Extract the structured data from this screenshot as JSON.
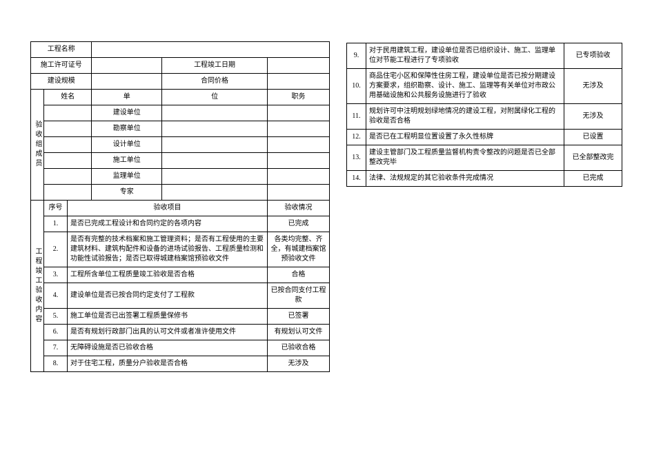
{
  "top": {
    "project_name_label": "工程名称",
    "permit_no_label": "施工许可证号",
    "completion_date_label": "工程竣工日期",
    "scale_label": "建设规模",
    "contract_price_label": "合同价格"
  },
  "group": {
    "side_label": "验收组成员",
    "name": "姓名",
    "unit": "单",
    "unit2": "位",
    "title": "职务",
    "rows": [
      "建设单位",
      "勘察单位",
      "设计单位",
      "施工单位",
      "监理单位"
    ],
    "expert": "专家"
  },
  "accept": {
    "side_label": "工程竣工验收内容",
    "seq": "序号",
    "item": "验收项目",
    "status": "验收情况",
    "rows": [
      {
        "n": "1.",
        "t": "是否已完成工程设计和合同约定的各项内容",
        "s": "已完成"
      },
      {
        "n": "2.",
        "t": "是否有完整的技术档案和施工管理资料；是否有工程使用的主要建筑材料、建筑构配件和设备的进场试验报告、工程质量检测和功能性试验报告；是否已取得城建档案馆预验收文件",
        "s": "各类均完整、齐全，有城建档案馆预验收文件"
      },
      {
        "n": "3.",
        "t": "工程所含单位工程质量竣工验收是否合格",
        "s": "合格"
      },
      {
        "n": "4.",
        "t": "建设单位是否已按合同约定支付了工程款",
        "s": "已按合同支付工程款"
      },
      {
        "n": "5.",
        "t": "施工单位是否已出签署工程质量保修书",
        "s": "已签署"
      },
      {
        "n": "6.",
        "t": "是否有规划行政部门出具的认可文件或者准许使用文件",
        "s": "有规划认可文件"
      },
      {
        "n": "7.",
        "t": "无障碍设施是否已验收合格",
        "s": "已验收合格"
      },
      {
        "n": "8.",
        "t": "对于住宅工程，质量分户验收是否合格",
        "s": "无涉及"
      }
    ]
  },
  "accept_cont": [
    {
      "n": "9.",
      "t": "对于民用建筑工程，建设单位是否已组织设计、施工、监理单位对节能工程进行了专项验收",
      "s": "已专项验收"
    },
    {
      "n": "10.",
      "t": "商品住宅小区和保障性住房工程，建设单位是否已按分期建设方案要求，组织勘察、设计、施工、监理等有关单位对市政公用基础设施和公共服务设施进行了验收",
      "s": "无涉及"
    },
    {
      "n": "11.",
      "t": "规划许可中注明规划绿地情况的建设工程，对附属绿化工程的验收是否合格",
      "s": "无涉及"
    },
    {
      "n": "12.",
      "t": "是否已在工程明显位置设置了永久性标牌",
      "s": "已设置"
    },
    {
      "n": "13.",
      "t": "建设主管部门及工程质量监督机构责令整改的问题是否已全部整改完毕",
      "s": "已全部整改完"
    },
    {
      "n": "14.",
      "t": "法律、法规规定的其它验收条件完成情况",
      "s": "已完成"
    }
  ]
}
